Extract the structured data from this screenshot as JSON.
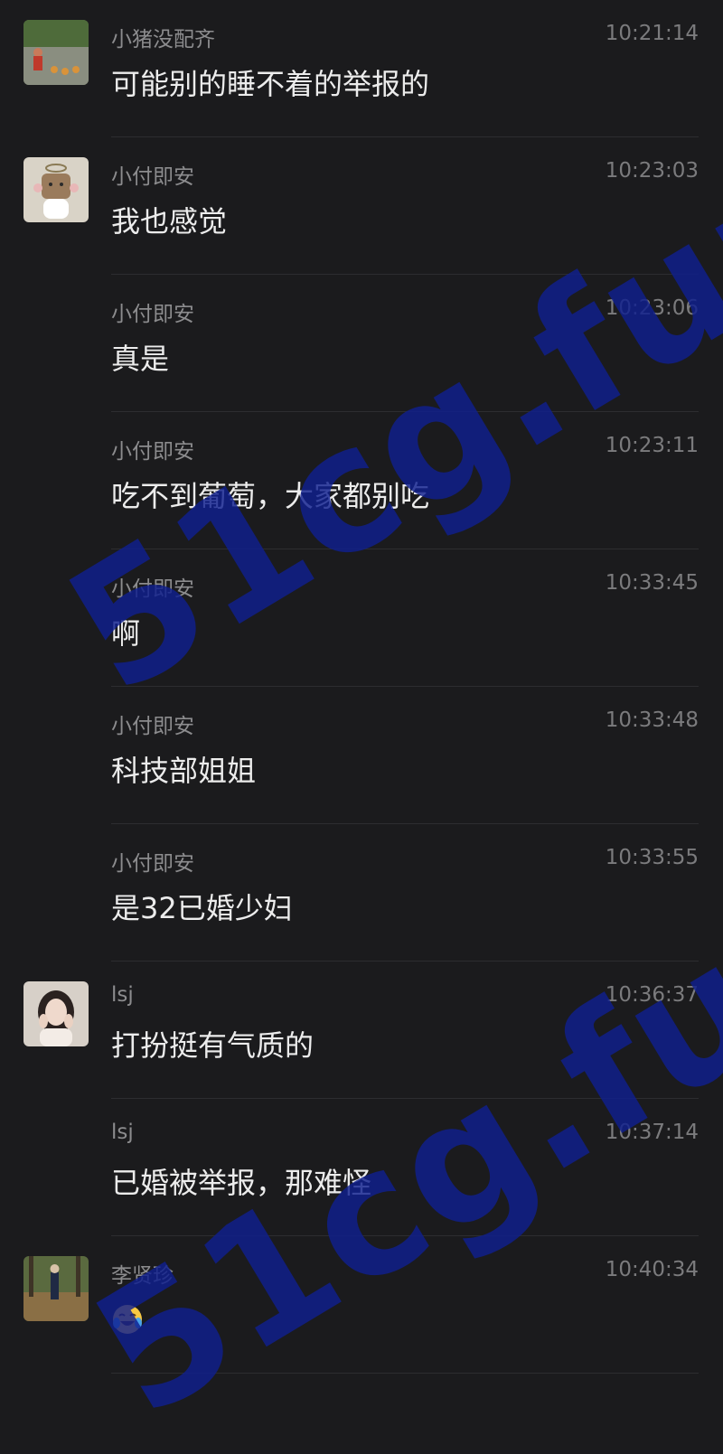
{
  "messages": [
    {
      "sender": "小猪没配齐",
      "time": "10:21:14",
      "text": "可能别的睡不着的举报的",
      "avatar": "photo-kid-ducks"
    },
    {
      "sender": "小付即安",
      "time": "10:23:03",
      "text": "我也感觉",
      "avatar": "cartoon-bear"
    },
    {
      "sender": "小付即安",
      "time": "10:23:06",
      "text": "真是"
    },
    {
      "sender": "小付即安",
      "time": "10:23:11",
      "text": "吃不到葡萄，大家都别吃"
    },
    {
      "sender": "小付即安",
      "time": "10:33:45",
      "text": "啊"
    },
    {
      "sender": "小付即安",
      "time": "10:33:48",
      "text": "科技部姐姐"
    },
    {
      "sender": "小付即安",
      "time": "10:33:55",
      "text": "是32已婚少妇"
    },
    {
      "sender": "lsj",
      "time": "10:36:37",
      "text": "打扮挺有气质的",
      "avatar": "photo-woman"
    },
    {
      "sender": "lsj",
      "time": "10:37:14",
      "text": "已婚被举报，那难怪"
    },
    {
      "sender": "李贤珍",
      "time": "10:40:34",
      "text": "",
      "emoji": "crying-laughing-emoji",
      "avatar": "photo-forest-path"
    }
  ],
  "watermark": {
    "text": "51cg.fun",
    "color": "#0f1f8f"
  },
  "colors": {
    "background": "#1b1b1d",
    "name": "#8c8c8e",
    "time": "#7b7b7d",
    "text": "#ececec",
    "divider": "#2d2d30"
  }
}
